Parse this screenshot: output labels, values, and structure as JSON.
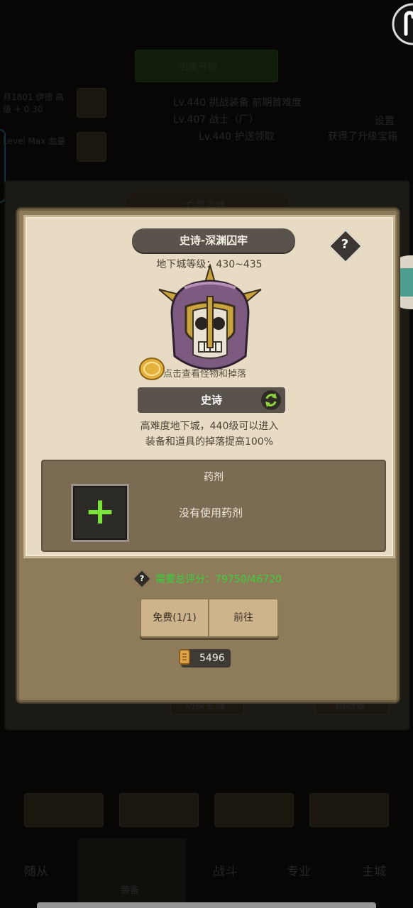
{
  "background": {
    "top_button": "加速升级",
    "lines": [
      "Lv.440 挑战装备 前期首难度",
      "Lv.407 战士（厂）",
      "Lv.440 护送领取",
      "设置",
      "获得了升级宝箱"
    ],
    "left_items": [
      "月1801 伊德 高级 + 0 30",
      "Level Max 血量"
    ],
    "panel_title": "亡灵之地",
    "panel_bottom_left": "切换主线",
    "panel_bottom_right": "回场景",
    "nav_items": [
      "随从",
      "战斗",
      "专业",
      "主城"
    ],
    "nav_center": "装备"
  },
  "modal": {
    "title": "史诗-深渊囚牢",
    "help_symbol": "?",
    "level_range": "地下城等级：430~435",
    "monster_hint": "点击查看怪物和掉落",
    "mode_label": "史诗",
    "description_lines": [
      "高难度地下城，440级可以进入",
      "装备和道具的掉落提高100%"
    ],
    "potion": {
      "title": "药剂",
      "add_symbol": "+",
      "status": "没有使用药剂"
    },
    "score": {
      "help_symbol": "?",
      "label": "需要总评分：79750/46720"
    },
    "free_button": "免费(1/1)",
    "go_button": "前往",
    "cost_value": "5496"
  },
  "colors": {
    "score_green": "#38d43a",
    "add_green": "#7be33a",
    "banner_dark": "#59534b",
    "parchment": "#e7dcc3"
  },
  "icons": [
    "skull-helmet-icon",
    "gold-coin-icon",
    "cycle-icon",
    "question-icon",
    "scroll-icon",
    "plus-icon",
    "fab-icon"
  ]
}
